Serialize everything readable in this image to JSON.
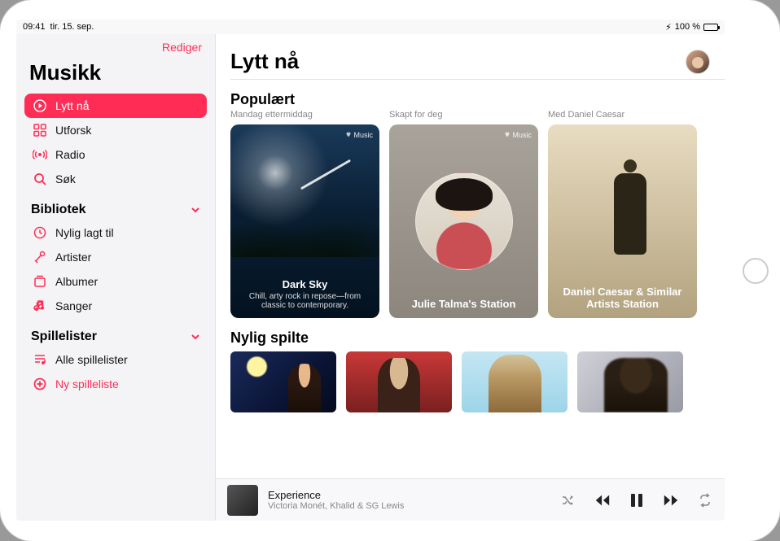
{
  "status": {
    "time": "09:41",
    "date": "tir. 15. sep.",
    "battery": "100 %",
    "charging_glyph": "⚡︎"
  },
  "sidebar": {
    "edit": "Rediger",
    "title": "Musikk",
    "nav": [
      {
        "label": "Lytt nå"
      },
      {
        "label": "Utforsk"
      },
      {
        "label": "Radio"
      },
      {
        "label": "Søk"
      }
    ],
    "library": {
      "header": "Bibliotek",
      "items": [
        {
          "label": "Nylig lagt til"
        },
        {
          "label": "Artister"
        },
        {
          "label": "Albumer"
        },
        {
          "label": "Sanger"
        }
      ]
    },
    "playlists": {
      "header": "Spillelister",
      "items": [
        {
          "label": "Alle spillelister"
        }
      ],
      "new_label": "Ny spilleliste"
    }
  },
  "main": {
    "title": "Lytt nå",
    "popular": {
      "header": "Populært",
      "cards": [
        {
          "sub": "Mandag ettermiddag",
          "badge": "Music",
          "title": "Dark Sky",
          "desc": "Chill, arty rock in repose—from classic to contemporary."
        },
        {
          "sub": "Skapt for deg",
          "badge": "Music",
          "title": "Julie Talma's Station",
          "desc": ""
        },
        {
          "sub": "Med Daniel Caesar",
          "badge": "",
          "title": "Daniel Caesar & Similar Artists Station",
          "desc": ""
        }
      ]
    },
    "recent": {
      "header": "Nylig spilte"
    }
  },
  "player": {
    "title": "Experience",
    "artist": "Victoria Monét, Khalid & SG Lewis"
  }
}
